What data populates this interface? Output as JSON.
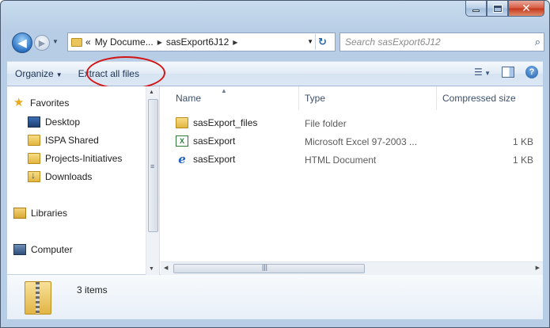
{
  "window": {
    "caption": {
      "minimize_icon": "minimize-icon",
      "maximize_icon": "maximize-icon",
      "close_label": "✕"
    }
  },
  "address": {
    "overflow": "«",
    "crumbs": [
      "My Docume...",
      "sasExport6J12"
    ],
    "search_placeholder": "Search sasExport6J12"
  },
  "commandbar": {
    "organize": "Organize",
    "extract": "Extract all files"
  },
  "nav": {
    "favorites": "Favorites",
    "items": [
      "Desktop",
      "ISPA Shared",
      "Projects-Initiatives",
      "Downloads"
    ],
    "libraries": "Libraries",
    "computer": "Computer"
  },
  "columns": {
    "name": "Name",
    "type": "Type",
    "size": "Compressed size"
  },
  "files": [
    {
      "name": "sasExport_files",
      "type": "File folder",
      "size": "",
      "icon": "folder-icon"
    },
    {
      "name": "sasExport",
      "type": "Microsoft Excel 97-2003 ...",
      "size": "1 KB",
      "icon": "excel-icon"
    },
    {
      "name": "sasExport",
      "type": "HTML Document",
      "size": "1 KB",
      "icon": "html-document-icon"
    }
  ],
  "details": {
    "count": "3 items"
  },
  "colors": {
    "annotation": "#d21414",
    "accent": "#2d73c3"
  }
}
